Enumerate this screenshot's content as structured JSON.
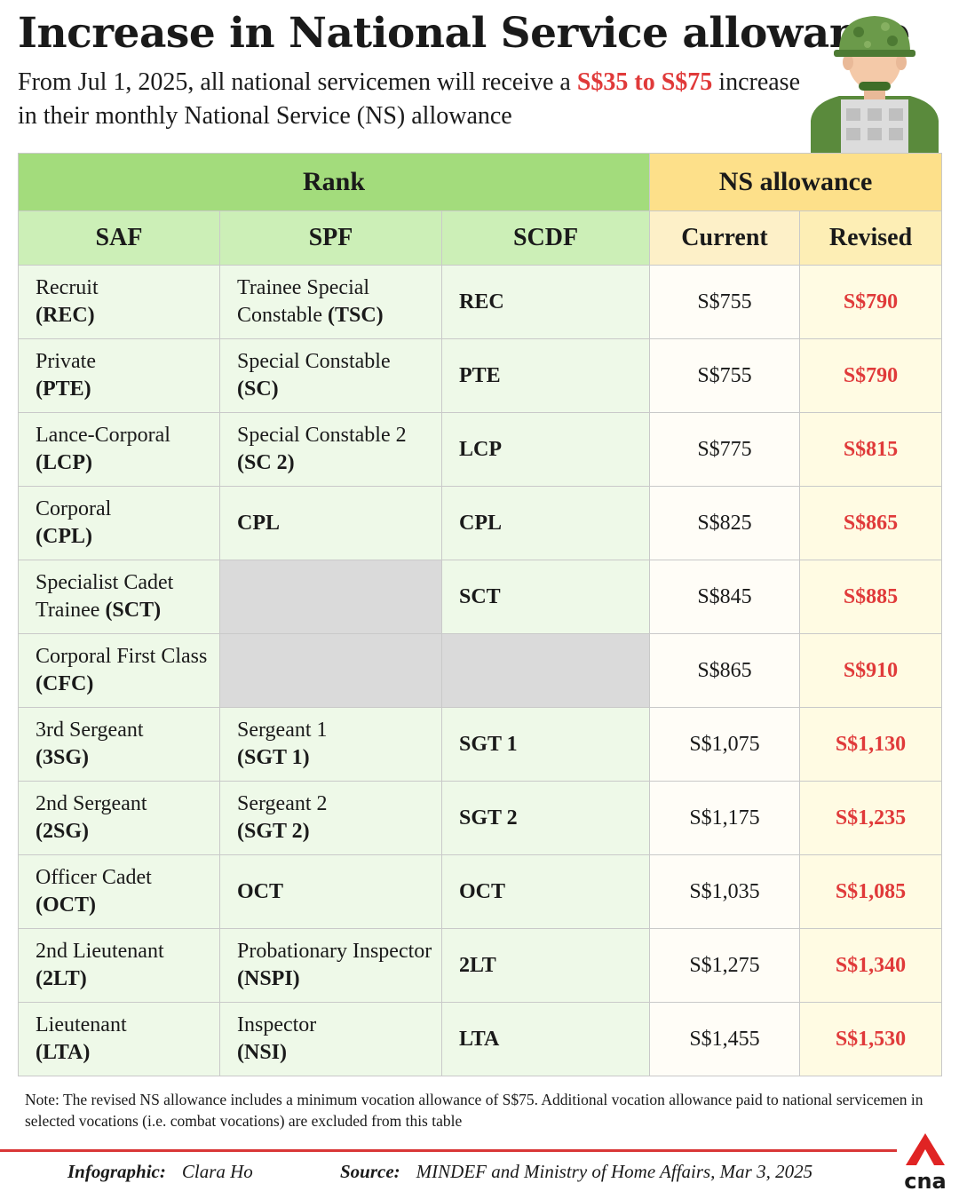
{
  "title": "Increase in National Service allowance",
  "subtitle": {
    "part1": "From Jul 1, 2025, all national servicemen will receive a ",
    "highlight": "S$35 to S$75",
    "part2": " increase in their monthly National Service (NS) allowance"
  },
  "table": {
    "group_rank": "Rank",
    "group_allowance": "NS allowance",
    "columns": {
      "saf": "SAF",
      "spf": "SPF",
      "scdf": "SCDF",
      "current": "Current",
      "revised": "Revised"
    },
    "rows": [
      {
        "saf": "Recruit",
        "saf_abbr": "(REC)",
        "spf": "Trainee Special Constable",
        "spf_abbr": "(TSC)",
        "scdf": "REC",
        "current": "S$755",
        "revised": "S$790"
      },
      {
        "saf": "Private",
        "saf_abbr": "(PTE)",
        "spf": "Special Constable",
        "spf_abbr": "(SC)",
        "scdf": "PTE",
        "current": "S$755",
        "revised": "S$790"
      },
      {
        "saf": "Lance-Corporal",
        "saf_abbr": "(LCP)",
        "spf": "Special Constable 2",
        "spf_abbr": "(SC 2)",
        "scdf": "LCP",
        "current": "S$775",
        "revised": "S$815"
      },
      {
        "saf": "Corporal",
        "saf_abbr": "(CPL)",
        "spf": "",
        "spf_abbr": "CPL",
        "scdf": "CPL",
        "current": "S$825",
        "revised": "S$865"
      },
      {
        "saf": "Specialist Cadet Trainee",
        "saf_abbr": "(SCT)",
        "spf": "",
        "spf_abbr": "",
        "scdf": "SCT",
        "current": "S$845",
        "revised": "S$885"
      },
      {
        "saf": "Corporal First Class",
        "saf_abbr": "(CFC)",
        "spf": "",
        "spf_abbr": "",
        "scdf": "",
        "current": "S$865",
        "revised": "S$910"
      },
      {
        "saf": "3rd Sergeant",
        "saf_abbr": "(3SG)",
        "spf": "Sergeant 1",
        "spf_abbr": "(SGT 1)",
        "scdf": "SGT 1",
        "current": "S$1,075",
        "revised": "S$1,130"
      },
      {
        "saf": "2nd Sergeant",
        "saf_abbr": "(2SG)",
        "spf": "Sergeant 2",
        "spf_abbr": "(SGT 2)",
        "scdf": "SGT 2",
        "current": "S$1,175",
        "revised": "S$1,235"
      },
      {
        "saf": "Officer Cadet",
        "saf_abbr": "(OCT)",
        "spf": "",
        "spf_abbr": "OCT",
        "scdf": "OCT",
        "current": "S$1,035",
        "revised": "S$1,085"
      },
      {
        "saf": "2nd Lieutenant",
        "saf_abbr": "(2LT)",
        "spf": "Probationary Inspector",
        "spf_abbr": "(NSPI)",
        "scdf": "2LT",
        "current": "S$1,275",
        "revised": "S$1,340"
      },
      {
        "saf": "Lieutenant",
        "saf_abbr": "(LTA)",
        "spf": "Inspector",
        "spf_abbr": "(NSI)",
        "scdf": "LTA",
        "current": "S$1,455",
        "revised": "S$1,530"
      }
    ]
  },
  "note": "Note: The revised NS allowance includes a minimum vocation allowance of S$75. Additional vocation allowance paid to national servicemen in selected vocations (i.e. combat vocations) are excluded from this table",
  "footer": {
    "infographic_label": "Infographic:",
    "infographic_value": "Clara Ho",
    "source_label": "Source:",
    "source_value": "MINDEF and Ministry of Home Affairs, Mar 3, 2025"
  },
  "logo_text": "cna",
  "icons": {
    "soldier": "soldier-icon",
    "logo": "cna-logo"
  },
  "colors": {
    "accent_red": "#e03a3a",
    "rank_green": "#a3dc7c",
    "allowance_yellow": "#fde08a"
  }
}
